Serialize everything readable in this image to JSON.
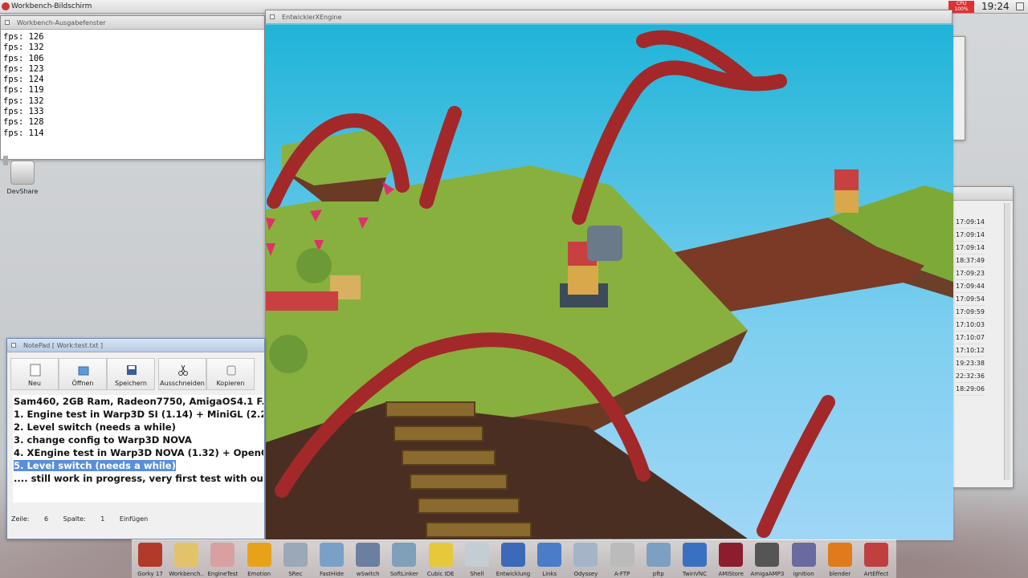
{
  "screen": {
    "title": "Workbench-Bildschirm",
    "clock": "19:24",
    "cpu_label": "CPU",
    "cpu_value": "100%"
  },
  "output_window": {
    "title": "Workbench-Ausgabefenster",
    "lines": [
      "fps: 126",
      "fps: 132",
      "fps: 106",
      "fps: 123",
      "fps: 124",
      "fps: 119",
      "fps: 132",
      "fps: 133",
      "fps: 128",
      "fps: 114"
    ]
  },
  "desktop_icon": {
    "label": "DevShare"
  },
  "engine_window": {
    "title": "EntwicklerXEngine"
  },
  "bg_list": {
    "times": [
      "17:09:14",
      "17:09:14",
      "17:09:14",
      "18:37:49",
      "17:09:23",
      "17:09:44",
      "17:09:54",
      "17:09:59",
      "17:10:03",
      "17:10:07",
      "17:10:12",
      "19:23:38",
      "22:32:36",
      "18:29:06"
    ]
  },
  "notepad": {
    "title": "NotePad [ Work:test.txt ]",
    "toolbar": [
      "Neu",
      "Öffnen",
      "Speichern",
      "Ausschneiden",
      "Kopieren"
    ],
    "lines": [
      "Sam460, 2GB Ram, Radeon7750, AmigaOS4.1 F.",
      "1. Engine test in Warp3D SI (1.14) + MiniGL (2.2",
      "2. Level switch (needs a while)",
      "3. change config to Warp3D NOVA",
      "4. XEngine test in Warp3D NOVA (1.32) + OpenG",
      "5. Level switch (needs a while)",
      ".... still work in progress, very first test with our"
    ],
    "status": {
      "line_label": "Zeile:",
      "line_value": "6",
      "col_label": "Spalte:",
      "col_value": "1",
      "mode": "Einfügen"
    }
  },
  "dock": [
    {
      "label": "Gorky 17",
      "color": "#b23a2a"
    },
    {
      "label": "Workbench..",
      "color": "#e3c36a"
    },
    {
      "label": "EngineTest",
      "color": "#d9a0a0"
    },
    {
      "label": "Emotion",
      "color": "#e8a21a"
    },
    {
      "label": "SRec",
      "color": "#9aa8b8"
    },
    {
      "label": "FastHide",
      "color": "#7aa0c8"
    },
    {
      "label": "wSwitch",
      "color": "#6b7fa0"
    },
    {
      "label": "SoftLinker",
      "color": "#7fa0b8"
    },
    {
      "label": "Cubic IDE",
      "color": "#e6c83a"
    },
    {
      "label": "Shell",
      "color": "#c4ccd4"
    },
    {
      "label": "Entwicklung",
      "color": "#3c6ab8"
    },
    {
      "label": "Links",
      "color": "#4a7cc8"
    },
    {
      "label": "Odyssey",
      "color": "#a6b4c8"
    },
    {
      "label": "A-FTP",
      "color": "#bbbbbb"
    },
    {
      "label": "pftp",
      "color": "#7da0c0"
    },
    {
      "label": "TwinVNC",
      "color": "#3a70c0"
    },
    {
      "label": "AMIStore",
      "color": "#8b1d2c"
    },
    {
      "label": "AmigaAMP3",
      "color": "#555555"
    },
    {
      "label": "ignition",
      "color": "#6a6aa0"
    },
    {
      "label": "blender",
      "color": "#e07a1a"
    },
    {
      "label": "ArtEffect",
      "color": "#c04040"
    }
  ]
}
